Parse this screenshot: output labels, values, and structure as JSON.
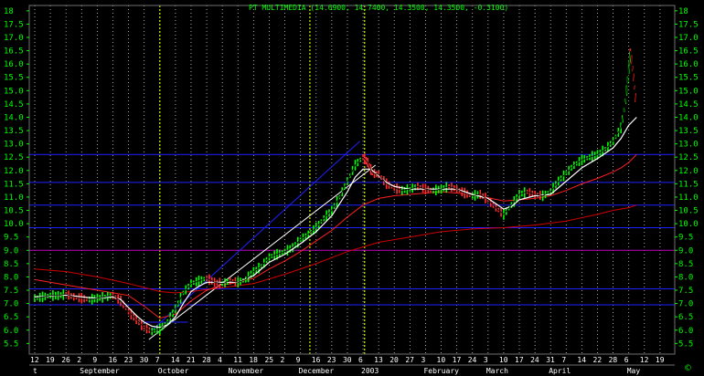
{
  "chart_data": {
    "type": "line",
    "title": "PT MULTIMEDIA (14.6900, 14.7400, 14.3500, 14.3500, -0.3100)",
    "copyright": "©",
    "ylim": [
      5.1,
      18.2
    ],
    "yticks": [
      "5.5",
      "6.0",
      "6.5",
      "7.0",
      "7.5",
      "8.0",
      "8.5",
      "9.0",
      "9.5",
      "10.0",
      "10.5",
      "11.0",
      "11.5",
      "12.0",
      "12.5",
      "13.0",
      "13.5",
      "14.0",
      "14.5",
      "15.0",
      "15.5",
      "16.0",
      "16.5",
      "17.0",
      "17.5",
      "18"
    ],
    "day_ticks": [
      "12",
      "19",
      "26",
      "2",
      "9",
      "16",
      "23",
      "30",
      "7",
      "14",
      "21",
      "28",
      "4",
      "11",
      "18",
      "25",
      "2",
      "9",
      "16",
      "23",
      "30",
      "6",
      "13",
      "20",
      "27",
      "3",
      "10",
      "17",
      "24",
      "3",
      "10",
      "17",
      "24",
      "31",
      "7",
      "14",
      "22",
      "28",
      "6",
      "12",
      "19"
    ],
    "month_labels": [
      {
        "label": "t",
        "x": 0
      },
      {
        "label": "September",
        "x": 3
      },
      {
        "label": "October",
        "x": 8
      },
      {
        "label": "November",
        "x": 12.5
      },
      {
        "label": "December",
        "x": 17
      },
      {
        "label": "2003",
        "x": 21
      },
      {
        "label": "February",
        "x": 25
      },
      {
        "label": "March",
        "x": 29
      },
      {
        "label": "April",
        "x": 33
      },
      {
        "label": "May",
        "x": 38
      }
    ],
    "special_days": [
      8,
      17.6,
      21.1
    ],
    "horizontal_levels": [
      {
        "y": 12.6,
        "color": "#2020ff"
      },
      {
        "y": 11.55,
        "color": "#2020ff"
      },
      {
        "y": 10.7,
        "color": "#2020ff"
      },
      {
        "y": 9.85,
        "color": "#2020ff"
      },
      {
        "y": 9.0,
        "color": "#c000c0"
      },
      {
        "y": 7.55,
        "color": "#2020ff"
      },
      {
        "y": 6.95,
        "color": "#2020ff"
      }
    ],
    "trendlines": [
      {
        "x1": 7.5,
        "y1": 6.0,
        "x2": 20.8,
        "y2": 13.1,
        "color": "#2020ff"
      },
      {
        "x1": 7.3,
        "y1": 5.65,
        "x2": 21.8,
        "y2": 12.2,
        "color": "#ffffff"
      },
      {
        "x1": 6.9,
        "y1": 6.3,
        "x2": 9.8,
        "y2": 6.3,
        "color": "#2020ff"
      }
    ],
    "price": [
      [
        0,
        7.2
      ],
      [
        0.5,
        7.25
      ],
      [
        1,
        7.3
      ],
      [
        1.5,
        7.3
      ],
      [
        2,
        7.35
      ],
      [
        2.5,
        7.25
      ],
      [
        3,
        7.2
      ],
      [
        3.5,
        7.15
      ],
      [
        4,
        7.2
      ],
      [
        4.5,
        7.25
      ],
      [
        5,
        7.3
      ],
      [
        5.5,
        7.1
      ],
      [
        6,
        6.7
      ],
      [
        6.5,
        6.4
      ],
      [
        7,
        6.1
      ],
      [
        7.5,
        5.95
      ],
      [
        8,
        6.05
      ],
      [
        8.5,
        6.3
      ],
      [
        9,
        6.8
      ],
      [
        9.5,
        7.4
      ],
      [
        10,
        7.75
      ],
      [
        10.5,
        7.85
      ],
      [
        11,
        7.95
      ],
      [
        11.5,
        7.8
      ],
      [
        12,
        7.75
      ],
      [
        12.5,
        7.85
      ],
      [
        13,
        7.8
      ],
      [
        13.5,
        7.9
      ],
      [
        14,
        8.2
      ],
      [
        14.5,
        8.4
      ],
      [
        15,
        8.75
      ],
      [
        15.5,
        8.85
      ],
      [
        16,
        8.95
      ],
      [
        16.5,
        9.1
      ],
      [
        17,
        9.4
      ],
      [
        17.5,
        9.6
      ],
      [
        18,
        9.85
      ],
      [
        18.5,
        10.2
      ],
      [
        19,
        10.5
      ],
      [
        19.5,
        11.0
      ],
      [
        20,
        11.6
      ],
      [
        20.5,
        12.2
      ],
      [
        21,
        12.5
      ],
      [
        21.3,
        12.3
      ],
      [
        21.6,
        11.9
      ],
      [
        22,
        11.85
      ],
      [
        22.5,
        11.5
      ],
      [
        23,
        11.35
      ],
      [
        23.5,
        11.25
      ],
      [
        24,
        11.3
      ],
      [
        24.5,
        11.4
      ],
      [
        25,
        11.3
      ],
      [
        25.5,
        11.25
      ],
      [
        26,
        11.3
      ],
      [
        26.5,
        11.4
      ],
      [
        27,
        11.3
      ],
      [
        27.5,
        11.15
      ],
      [
        28,
        11.05
      ],
      [
        28.5,
        11.1
      ],
      [
        29,
        10.9
      ],
      [
        29.5,
        10.6
      ],
      [
        30,
        10.35
      ],
      [
        30.5,
        10.7
      ],
      [
        31,
        11.1
      ],
      [
        31.5,
        11.2
      ],
      [
        32,
        11.1
      ],
      [
        32.5,
        11.05
      ],
      [
        33,
        11.2
      ],
      [
        33.5,
        11.6
      ],
      [
        34,
        11.9
      ],
      [
        34.5,
        12.2
      ],
      [
        35,
        12.4
      ],
      [
        35.5,
        12.5
      ],
      [
        36,
        12.6
      ],
      [
        36.5,
        12.8
      ],
      [
        37,
        13.1
      ],
      [
        37.5,
        13.6
      ],
      [
        37.8,
        14.6
      ],
      [
        38,
        15.8
      ],
      [
        38.1,
        16.5
      ],
      [
        38.3,
        15.5
      ],
      [
        38.5,
        14.35
      ]
    ],
    "short_ma": [
      [
        0,
        7.25
      ],
      [
        1,
        7.28
      ],
      [
        2,
        7.32
      ],
      [
        3,
        7.25
      ],
      [
        4,
        7.2
      ],
      [
        5,
        7.25
      ],
      [
        5.5,
        7.15
      ],
      [
        6,
        6.85
      ],
      [
        6.5,
        6.55
      ],
      [
        7,
        6.3
      ],
      [
        7.5,
        6.15
      ],
      [
        8,
        6.1
      ],
      [
        8.5,
        6.2
      ],
      [
        9,
        6.5
      ],
      [
        9.5,
        7.0
      ],
      [
        10,
        7.45
      ],
      [
        10.5,
        7.65
      ],
      [
        11,
        7.8
      ],
      [
        11.5,
        7.8
      ],
      [
        12,
        7.8
      ],
      [
        13,
        7.8
      ],
      [
        14,
        8.05
      ],
      [
        15,
        8.55
      ],
      [
        16,
        8.85
      ],
      [
        17,
        9.25
      ],
      [
        18,
        9.7
      ],
      [
        19,
        10.3
      ],
      [
        20,
        11.2
      ],
      [
        20.5,
        11.75
      ],
      [
        21,
        12.05
      ],
      [
        21.5,
        12.05
      ],
      [
        22,
        11.8
      ],
      [
        22.5,
        11.55
      ],
      [
        23,
        11.4
      ],
      [
        24,
        11.3
      ],
      [
        25,
        11.3
      ],
      [
        26,
        11.3
      ],
      [
        27,
        11.3
      ],
      [
        28,
        11.1
      ],
      [
        29,
        10.95
      ],
      [
        29.5,
        10.75
      ],
      [
        30,
        10.55
      ],
      [
        30.5,
        10.65
      ],
      [
        31,
        10.9
      ],
      [
        32,
        11.05
      ],
      [
        33,
        11.1
      ],
      [
        34,
        11.6
      ],
      [
        35,
        12.1
      ],
      [
        36,
        12.45
      ],
      [
        37,
        12.85
      ],
      [
        37.5,
        13.2
      ],
      [
        38,
        13.7
      ],
      [
        38.5,
        14.0
      ]
    ],
    "medium_ma": [
      [
        0,
        7.9
      ],
      [
        2,
        7.7
      ],
      [
        4,
        7.5
      ],
      [
        6,
        7.3
      ],
      [
        7,
        6.9
      ],
      [
        8,
        6.45
      ],
      [
        9,
        6.6
      ],
      [
        10,
        7.1
      ],
      [
        11,
        7.5
      ],
      [
        12,
        7.7
      ],
      [
        13,
        7.8
      ],
      [
        14,
        7.95
      ],
      [
        15,
        8.3
      ],
      [
        16,
        8.6
      ],
      [
        17,
        8.95
      ],
      [
        18,
        9.35
      ],
      [
        19,
        9.75
      ],
      [
        20,
        10.25
      ],
      [
        21,
        10.7
      ],
      [
        22,
        10.95
      ],
      [
        23,
        11.05
      ],
      [
        24,
        11.1
      ],
      [
        26,
        11.2
      ],
      [
        28,
        11.1
      ],
      [
        30,
        10.85
      ],
      [
        31,
        10.9
      ],
      [
        32,
        10.95
      ],
      [
        33,
        11.05
      ],
      [
        34,
        11.25
      ],
      [
        35,
        11.5
      ],
      [
        36,
        11.7
      ],
      [
        37,
        11.95
      ],
      [
        37.5,
        12.1
      ],
      [
        38,
        12.3
      ],
      [
        38.5,
        12.6
      ]
    ],
    "long_ma": [
      [
        0,
        8.3
      ],
      [
        2,
        8.2
      ],
      [
        4,
        8.0
      ],
      [
        6,
        7.75
      ],
      [
        8,
        7.45
      ],
      [
        9,
        7.4
      ],
      [
        10,
        7.45
      ],
      [
        12,
        7.6
      ],
      [
        14,
        7.75
      ],
      [
        16,
        8.1
      ],
      [
        18,
        8.5
      ],
      [
        20,
        8.95
      ],
      [
        22,
        9.3
      ],
      [
        24,
        9.5
      ],
      [
        26,
        9.7
      ],
      [
        28,
        9.8
      ],
      [
        30,
        9.85
      ],
      [
        32,
        9.95
      ],
      [
        34,
        10.1
      ],
      [
        36,
        10.35
      ],
      [
        37,
        10.5
      ],
      [
        38,
        10.6
      ],
      [
        38.5,
        10.7
      ]
    ]
  }
}
